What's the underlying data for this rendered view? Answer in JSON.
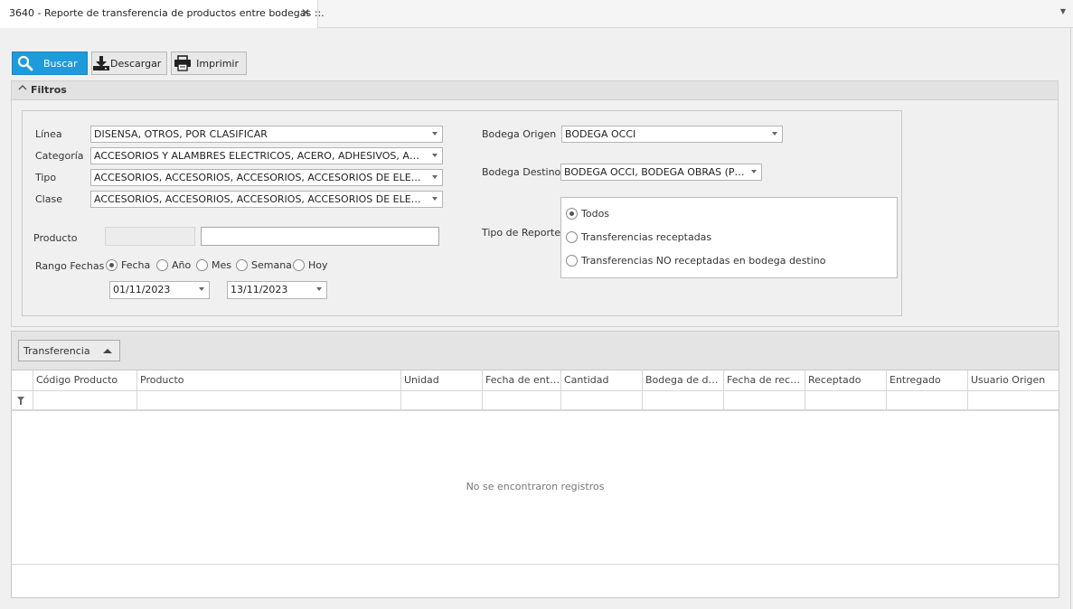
{
  "tab": {
    "title": "3640 - Reporte de transferencia de productos entre bodegas ::."
  },
  "toolbar": {
    "search_label": "Buscar",
    "download_label": "Descargar",
    "print_label": "Imprimir"
  },
  "filters": {
    "title": "Filtros",
    "linea_label": "Línea",
    "linea_value": "DISENSA, OTROS, POR CLASIFICAR",
    "categoria_label": "Categoría",
    "categoria_value": "ACCESORIOS Y ALAMBRES ELECTRICOS, ACERO, ADHESIVOS, ADITIVOS...",
    "tipo_label": "Tipo",
    "tipo_value": "ACCESORIOS, ACCESORIOS, ACCESORIOS, ACCESORIOS DE ELECTROB...",
    "clase_label": "Clase",
    "clase_value": "ACCESORIOS, ACCESORIOS, ACCESORIOS, ACCESORIOS DE ELECTROB...",
    "producto_label": "Producto",
    "producto_code": "",
    "producto_value": "",
    "rango_label": "Rango Fechas",
    "rango_options": [
      "Fecha",
      "Año",
      "Mes",
      "Semana",
      "Hoy"
    ],
    "rango_selected": "Fecha",
    "fecha_desde": "01/11/2023",
    "fecha_hasta": "13/11/2023",
    "bodega_origen_label": "Bodega Origen",
    "bodega_origen_value": "BODEGA OCCI",
    "bodega_destino_label": "Bodega Destino",
    "bodega_destino_value": "BODEGA OCCI, BODEGA OBRAS (POR ...",
    "tipo_reporte_label": "Tipo de Reporte",
    "tipo_reporte_options": [
      "Todos",
      "Transferencias receptadas",
      "Transferencias NO receptadas en bodega destino"
    ],
    "tipo_reporte_selected": "Todos"
  },
  "grid": {
    "group_column": "Transferencia",
    "columns": [
      "Código Producto",
      "Producto",
      "Unidad",
      "Fecha de entr...",
      "Cantidad",
      "Bodega de dest...",
      "Fecha de recep...",
      "Receptado",
      "Entregado",
      "Usuario Origen"
    ],
    "empty_message": "No se encontraron registros"
  }
}
